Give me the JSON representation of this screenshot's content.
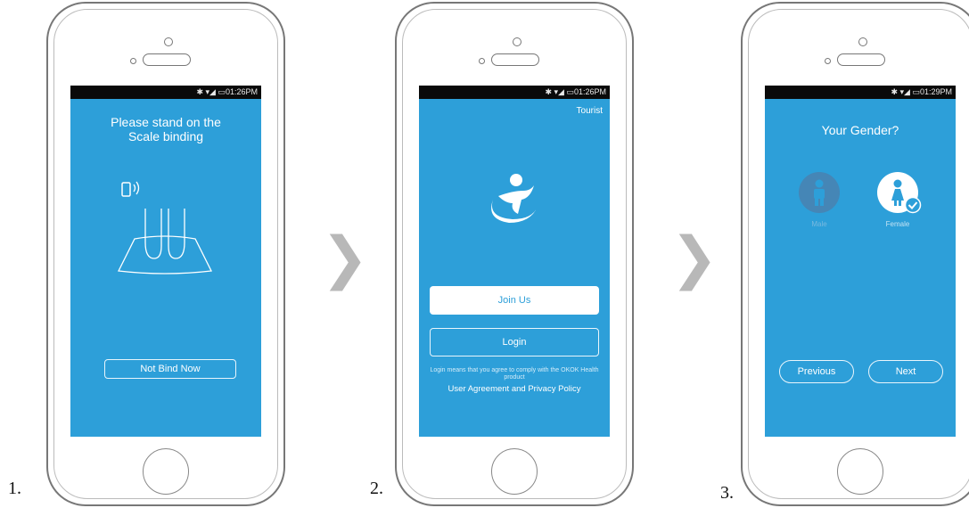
{
  "steps": [
    {
      "number": "1.",
      "status_time": "✱ ▾◢ ▭01:26PM",
      "title": "Please stand on the Scale binding",
      "primary_button": "Not Bind Now"
    },
    {
      "number": "2.",
      "status_time": "✱ ▾◢ ▭01:26PM",
      "tourist_link": "Tourist",
      "join_button": "Join Us",
      "login_button": "Login",
      "terms_note": "Login means that you agree to comply with the OKOK Health product",
      "policy_link": "User Agreement and Privacy Policy"
    },
    {
      "number": "3.",
      "status_time": "✱ ▾◢ ▭01:29PM",
      "title": "Your Gender?",
      "male_label": "Male",
      "female_label": "Female",
      "previous_button": "Previous",
      "next_button": "Next"
    }
  ],
  "arrows": [
    "❯",
    "❯"
  ],
  "colors": {
    "screen": "#2d9fd9",
    "statusbar": "#0a0a0a",
    "chevron": "#b8b8b8"
  }
}
